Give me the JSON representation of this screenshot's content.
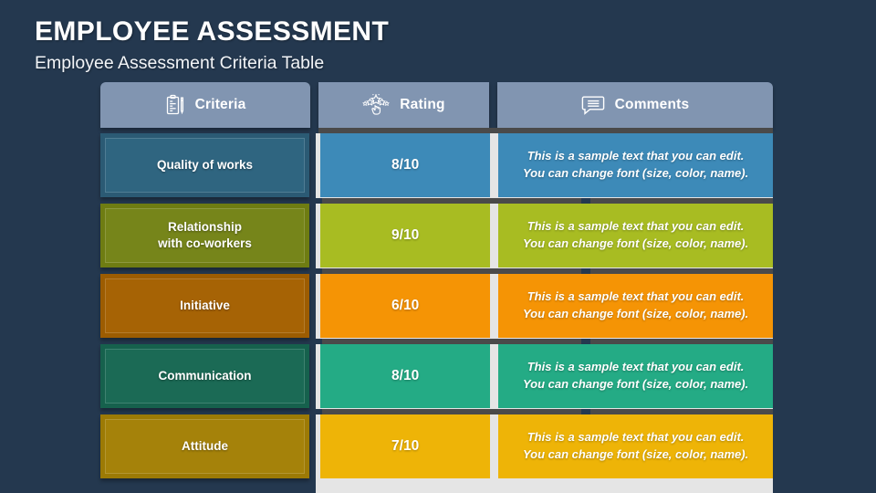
{
  "slide": {
    "background_color": "#24384f",
    "title": "EMPLOYEE ASSESSMENT",
    "subtitle": "Employee Assessment Criteria Table"
  },
  "table": {
    "header_background": "#8195b1",
    "panel_background": "#e5e5e5",
    "separator_color": "#4a4a4a",
    "columns": [
      {
        "label": "Criteria",
        "icon": "clipboard-pen-icon"
      },
      {
        "label": "Rating",
        "icon": "hand-stars-rating-icon"
      },
      {
        "label": "Comments",
        "icon": "speech-bubble-icon"
      }
    ],
    "rows": [
      {
        "criteria": "Quality of works",
        "rating": "8/10",
        "comment_line1": "This is a sample text that you can edit.",
        "comment_line2": "You can change font (size, color, name).",
        "criteria_color": "#2b5a74",
        "criteria_inner_color": "#2f6580",
        "accent_color": "#3d8ab8"
      },
      {
        "criteria": "Relationship\nwith co-workers",
        "rating": "9/10",
        "comment_line1": "This is a sample text that you can edit.",
        "comment_line2": "You can change font (size, color, name).",
        "criteria_color": "#6e7c12",
        "criteria_inner_color": "#76851a",
        "accent_color": "#a8bc22"
      },
      {
        "criteria": "Initiative",
        "rating": "6/10",
        "comment_line1": "This is a sample text that you can edit.",
        "comment_line2": "You can change font (size, color, name).",
        "criteria_color": "#9c5c01",
        "criteria_inner_color": "#a66305",
        "accent_color": "#f59405"
      },
      {
        "criteria": "Communication",
        "rating": "8/10",
        "comment_line1": "This is a sample text that you can edit.",
        "comment_line2": "You can change font (size, color, name).",
        "criteria_color": "#16614d",
        "criteria_inner_color": "#1b6a55",
        "accent_color": "#24ab85"
      },
      {
        "criteria": "Attitude",
        "rating": "7/10",
        "comment_line1": "This is a sample text that you can edit.",
        "comment_line2": "You can change font (size, color, name).",
        "criteria_color": "#9c7a05",
        "criteria_inner_color": "#a5820a",
        "accent_color": "#eeb407"
      }
    ]
  }
}
